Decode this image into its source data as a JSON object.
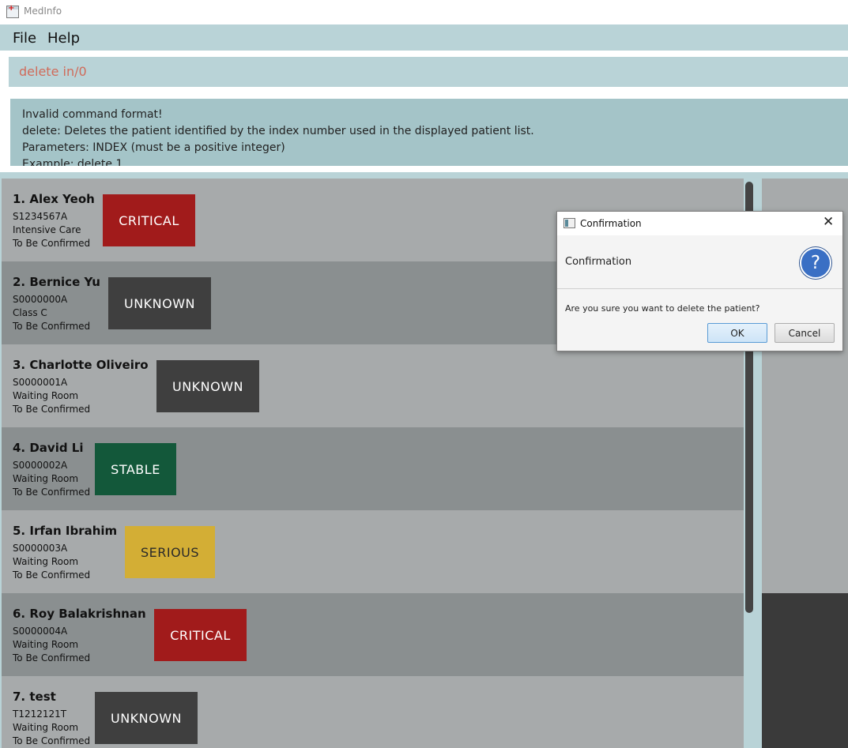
{
  "window": {
    "title": "MedInfo"
  },
  "menu": {
    "items": [
      "File",
      "Help"
    ]
  },
  "command": {
    "value": "delete in/0"
  },
  "result": {
    "lines": [
      "Invalid command format!",
      "delete: Deletes the patient identified by the index number used in the displayed patient list.",
      "Parameters: INDEX (must be a positive integer)",
      "Example: delete 1"
    ]
  },
  "patients": [
    {
      "name": "1.  Alex Yeoh",
      "nric": "S1234567A",
      "ward": "Intensive Care",
      "discharge": "To Be Confirmed",
      "status": "CRITICAL",
      "color": "#a11b1b"
    },
    {
      "name": "2.  Bernice Yu",
      "nric": "S0000000A",
      "ward": "Class C",
      "discharge": "To Be Confirmed",
      "status": "UNKNOWN",
      "color": "#3f3f3f"
    },
    {
      "name": "3.  Charlotte Oliveiro",
      "nric": "S0000001A",
      "ward": "Waiting Room",
      "discharge": "To Be Confirmed",
      "status": "UNKNOWN",
      "color": "#3f3f3f"
    },
    {
      "name": "4.  David Li",
      "nric": "S0000002A",
      "ward": "Waiting Room",
      "discharge": "To Be Confirmed",
      "status": "STABLE",
      "color": "#13583a"
    },
    {
      "name": "5.  Irfan Ibrahim",
      "nric": "S0000003A",
      "ward": "Waiting Room",
      "discharge": "To Be Confirmed",
      "status": "SERIOUS",
      "color": "#d3ae35"
    },
    {
      "name": "6.  Roy Balakrishnan",
      "nric": "S0000004A",
      "ward": "Waiting Room",
      "discharge": "To Be Confirmed",
      "status": "CRITICAL",
      "color": "#a11b1b"
    },
    {
      "name": "7.  test",
      "nric": "T1212121T",
      "ward": "Waiting Room",
      "discharge": "To Be Confirmed",
      "status": "UNKNOWN",
      "color": "#3f3f3f"
    }
  ],
  "dialog": {
    "title": "Confirmation",
    "header": "Confirmation",
    "message": "Are you sure you want to delete the patient?",
    "ok_label": "OK",
    "cancel_label": "Cancel",
    "close_glyph": "✕",
    "question_glyph": "?"
  }
}
